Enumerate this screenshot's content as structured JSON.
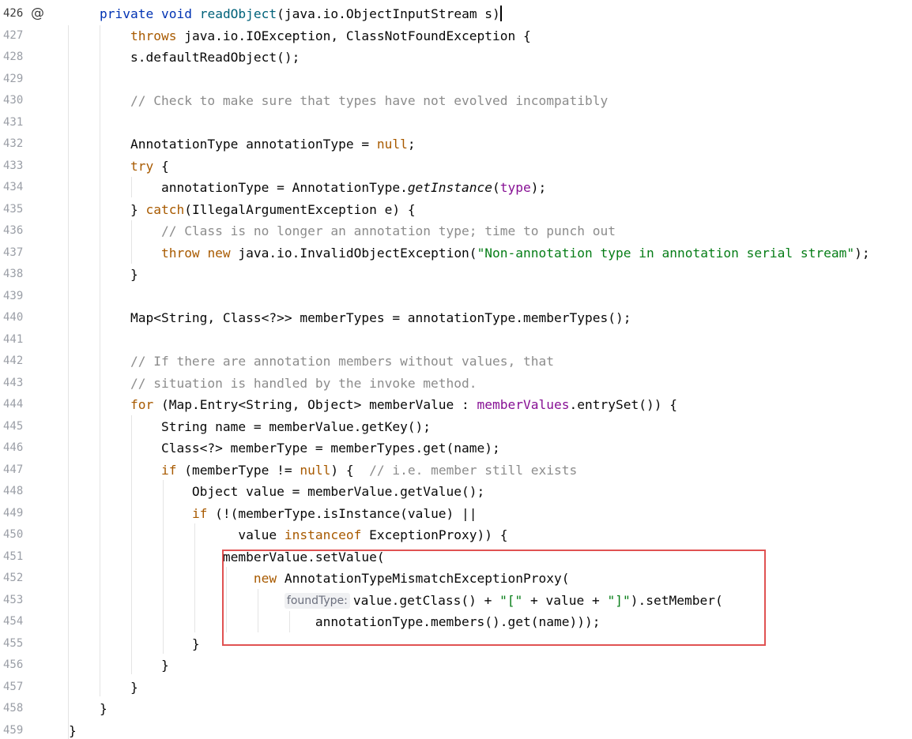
{
  "editor": {
    "gutter_icon": "at-override-icon",
    "inlay_hint": "foundType:",
    "lines": [
      {
        "num": "426",
        "code": [
          [
            "    ",
            ""
          ],
          [
            "private",
            "kw"
          ],
          [
            " ",
            ""
          ],
          [
            "void",
            "kw"
          ],
          [
            " ",
            ""
          ],
          [
            "readObject",
            "fn"
          ],
          [
            "(java.io.ObjectInputStream s)",
            ""
          ]
        ]
      },
      {
        "num": "427",
        "code": [
          [
            "        ",
            ""
          ],
          [
            "throws",
            "kw2"
          ],
          [
            " java.io.IOException, ClassNotFoundException {",
            ""
          ]
        ]
      },
      {
        "num": "428",
        "code": [
          [
            "        s.defaultReadObject();",
            ""
          ]
        ]
      },
      {
        "num": "429",
        "code": []
      },
      {
        "num": "430",
        "code": [
          [
            "        ",
            ""
          ],
          [
            "// Check to make sure that types have not evolved incompatibly",
            "cmt"
          ]
        ]
      },
      {
        "num": "431",
        "code": []
      },
      {
        "num": "432",
        "code": [
          [
            "        AnnotationType annotationType = ",
            ""
          ],
          [
            "null",
            "kw2"
          ],
          [
            ";",
            ""
          ]
        ]
      },
      {
        "num": "433",
        "code": [
          [
            "        ",
            ""
          ],
          [
            "try",
            "kw2"
          ],
          [
            " {",
            ""
          ]
        ]
      },
      {
        "num": "434",
        "code": [
          [
            "            annotationType = AnnotationType.",
            ""
          ],
          [
            "getInstance",
            "it"
          ],
          [
            "(",
            ""
          ],
          [
            "type",
            "fld"
          ],
          [
            ");",
            ""
          ]
        ]
      },
      {
        "num": "435",
        "code": [
          [
            "        } ",
            ""
          ],
          [
            "catch",
            "kw2"
          ],
          [
            "(IllegalArgumentException e) {",
            ""
          ]
        ]
      },
      {
        "num": "436",
        "code": [
          [
            "            ",
            ""
          ],
          [
            "// Class is no longer an annotation type; time to punch out",
            "cmt"
          ]
        ]
      },
      {
        "num": "437",
        "code": [
          [
            "            ",
            ""
          ],
          [
            "throw",
            "kw2"
          ],
          [
            " ",
            ""
          ],
          [
            "new",
            "kw2"
          ],
          [
            " java.io.InvalidObjectException(",
            ""
          ],
          [
            "\"Non-annotation type in annotation serial stream\"",
            "str"
          ],
          [
            ");",
            ""
          ]
        ]
      },
      {
        "num": "438",
        "code": [
          [
            "        }",
            ""
          ]
        ]
      },
      {
        "num": "439",
        "code": []
      },
      {
        "num": "440",
        "code": [
          [
            "        Map<String, Class<?>> memberTypes = annotationType.memberTypes();",
            ""
          ]
        ]
      },
      {
        "num": "441",
        "code": []
      },
      {
        "num": "442",
        "code": [
          [
            "        ",
            ""
          ],
          [
            "// If there are annotation members without values, that",
            "cmt"
          ]
        ]
      },
      {
        "num": "443",
        "code": [
          [
            "        ",
            ""
          ],
          [
            "// situation is handled by the invoke method.",
            "cmt"
          ]
        ]
      },
      {
        "num": "444",
        "code": [
          [
            "        ",
            ""
          ],
          [
            "for",
            "kw2"
          ],
          [
            " (Map.Entry<String, Object> memberValue : ",
            ""
          ],
          [
            "memberValues",
            "fld"
          ],
          [
            ".entrySet()) {",
            ""
          ]
        ]
      },
      {
        "num": "445",
        "code": [
          [
            "            String name = memberValue.getKey();",
            ""
          ]
        ]
      },
      {
        "num": "446",
        "code": [
          [
            "            Class<?> memberType = memberTypes.get(name);",
            ""
          ]
        ]
      },
      {
        "num": "447",
        "code": [
          [
            "            ",
            ""
          ],
          [
            "if",
            "kw2"
          ],
          [
            " (memberType != ",
            ""
          ],
          [
            "null",
            "kw2"
          ],
          [
            ") {  ",
            ""
          ],
          [
            "// i.e. member still exists",
            "cmt"
          ]
        ]
      },
      {
        "num": "448",
        "code": [
          [
            "                Object value = memberValue.getValue();",
            ""
          ]
        ]
      },
      {
        "num": "449",
        "code": [
          [
            "                ",
            ""
          ],
          [
            "if",
            "kw2"
          ],
          [
            " (!(memberType.isInstance(value) ||",
            ""
          ]
        ]
      },
      {
        "num": "450",
        "code": [
          [
            "                      value ",
            ""
          ],
          [
            "instanceof",
            "kw2"
          ],
          [
            " ExceptionProxy)) {",
            ""
          ]
        ]
      },
      {
        "num": "451",
        "code": [
          [
            "                    memberValue.setValue(",
            ""
          ]
        ]
      },
      {
        "num": "452",
        "code": [
          [
            "                        ",
            ""
          ],
          [
            "new",
            "kw2"
          ],
          [
            " AnnotationTypeMismatchExceptionProxy(",
            ""
          ]
        ]
      },
      {
        "num": "453",
        "code": [
          [
            "                            ",
            ""
          ],
          [
            "@hint",
            ""
          ],
          [
            "value.getClass() + ",
            ""
          ],
          [
            "\"[\"",
            "str"
          ],
          [
            " + value + ",
            ""
          ],
          [
            "\"]\"",
            "str"
          ],
          [
            ").setMember(",
            ""
          ]
        ]
      },
      {
        "num": "454",
        "code": [
          [
            "                                annotationType.members().get(name)));",
            ""
          ]
        ]
      },
      {
        "num": "455",
        "code": [
          [
            "                }",
            ""
          ]
        ]
      },
      {
        "num": "456",
        "code": [
          [
            "            }",
            ""
          ]
        ]
      },
      {
        "num": "457",
        "code": [
          [
            "        }",
            ""
          ]
        ]
      },
      {
        "num": "458",
        "code": [
          [
            "    }",
            ""
          ]
        ]
      },
      {
        "num": "459",
        "code": [
          [
            "}",
            ""
          ]
        ]
      }
    ]
  },
  "colors": {
    "keyword": "#a85a00",
    "keyword_decl": "#0033b3",
    "method_decl": "#00627a",
    "string": "#067d17",
    "comment": "#8c8c8c",
    "field": "#871094",
    "highlight_border": "#e05252"
  }
}
